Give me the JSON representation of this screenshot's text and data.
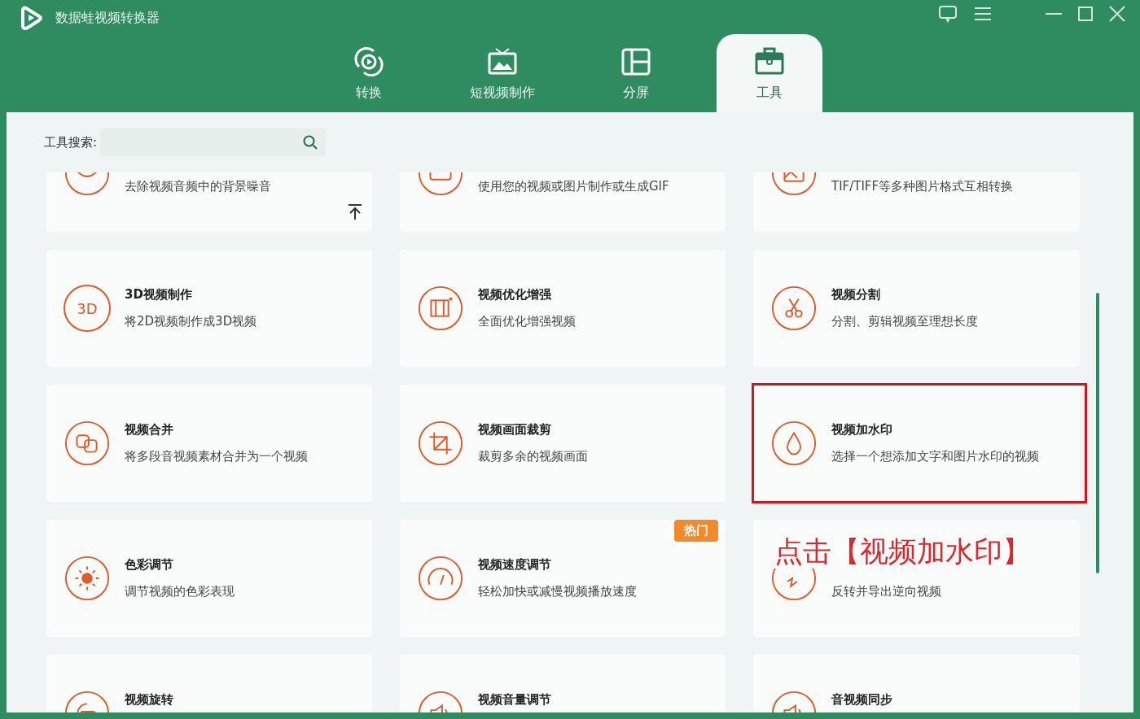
{
  "window": {
    "title": "数据蛙视频转换器"
  },
  "tabs": [
    {
      "label": "转换",
      "selected": false
    },
    {
      "label": "短视频制作",
      "selected": false
    },
    {
      "label": "分屏",
      "selected": false
    },
    {
      "label": "工具",
      "selected": true
    }
  ],
  "search": {
    "label": "工具搜索:"
  },
  "tools": [
    {
      "description": "去除视频音频中的背景噪音",
      "highlighted": false
    },
    {
      "description": "使用您的视频或图片制作或生成GIF",
      "highlighted": false
    },
    {
      "description": "TIF/TIFF等多种图片格式互相转换",
      "highlighted": false
    },
    {
      "title": "3D视频制作",
      "description": "将2D视频制作成3D视频",
      "icon_text": "3D",
      "highlighted": false
    },
    {
      "title": "视频优化增强",
      "description": "全面优化增强视频",
      "highlighted": false
    },
    {
      "title": "视频分割",
      "description": "分割、剪辑视频至理想长度",
      "highlighted": false
    },
    {
      "title": "视频合并",
      "description": "将多段音视频素材合并为一个视频",
      "highlighted": false
    },
    {
      "title": "视频画面裁剪",
      "description": "裁剪多余的视频画面",
      "highlighted": false
    },
    {
      "title": "视频加水印",
      "description": "选择一个想添加文字和图片水印的视频",
      "highlighted": true
    },
    {
      "title": "色彩调节",
      "description": "调节视频的色彩表现",
      "highlighted": false
    },
    {
      "title": "视频速度调节",
      "description": "轻松加快或减慢视频播放速度",
      "badge": "热门",
      "highlighted": false
    },
    {
      "description": "反转并导出逆向视频",
      "callout": "点击【视频加水印】",
      "highlighted": false
    },
    {
      "title": "视频旋转",
      "highlighted": false
    },
    {
      "title": "视频音量调节",
      "highlighted": false
    },
    {
      "title": "音视频同步",
      "highlighted": false
    }
  ]
}
